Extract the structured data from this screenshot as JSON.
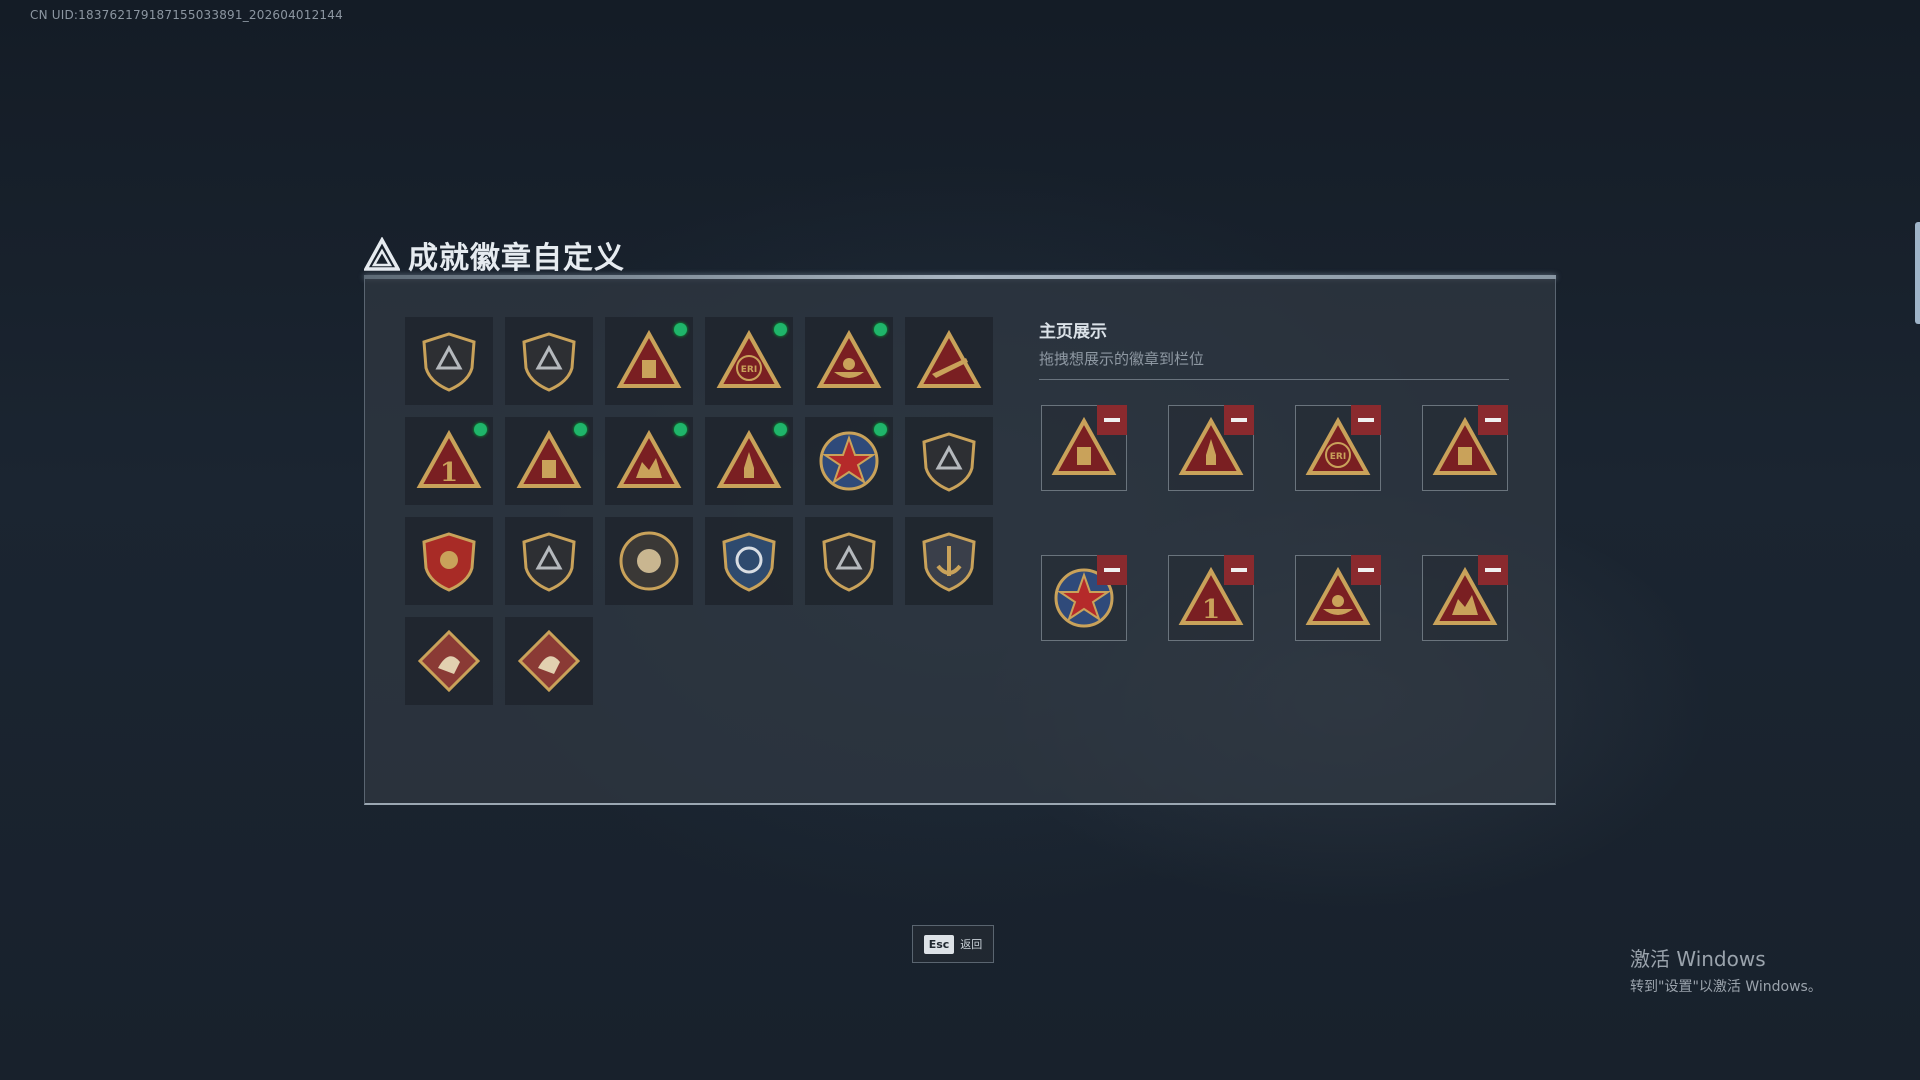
{
  "uid_text": "CN UID:183762179187155033891_202604012144",
  "title": "成就徽章自定义",
  "showcase": {
    "title": "主页展示",
    "subtitle": "拖拽想展示的徽章到栏位"
  },
  "esc": {
    "key": "Esc",
    "label": "返回"
  },
  "windows_watermark": {
    "title": "激活 Windows",
    "subtitle": "转到\"设置\"以激活 Windows。"
  },
  "colors": {
    "accent_green": "#1fb56a",
    "remove_red": "#8a2a2e",
    "gold": "#c9a25a",
    "badge_red": "#7a1f22"
  },
  "badges": [
    {
      "icon": "shield-triangle-badge-icon",
      "new": false
    },
    {
      "icon": "helicopter-shield-badge-icon",
      "new": false
    },
    {
      "icon": "lantern-triangle-badge-icon",
      "new": true
    },
    {
      "icon": "eri-globe-triangle-badge-icon",
      "new": true
    },
    {
      "icon": "boat-triangle-badge-icon",
      "new": true
    },
    {
      "icon": "rifle-triangle-badge-icon",
      "new": false
    },
    {
      "icon": "number-one-triangle-badge-icon",
      "new": true
    },
    {
      "icon": "crate-triangle-badge-icon",
      "new": true
    },
    {
      "icon": "soldiers-triangle-badge-icon",
      "new": true
    },
    {
      "icon": "rocket-triangle-badge-icon",
      "new": true
    },
    {
      "icon": "star-medal-badge-icon",
      "new": true
    },
    {
      "icon": "crest-shield-badge-icon",
      "new": false
    },
    {
      "icon": "eagle-crest-badge-icon",
      "new": false
    },
    {
      "icon": "helmet-shield-badge-icon",
      "new": false
    },
    {
      "icon": "flower-circle-badge-icon",
      "new": false
    },
    {
      "icon": "blue-target-shield-badge-icon",
      "new": false
    },
    {
      "icon": "gun-shield-badge-icon",
      "new": false
    },
    {
      "icon": "gold-anchor-shield-badge-icon",
      "new": false
    },
    {
      "icon": "dragon-diamond-badge-icon",
      "new": false
    },
    {
      "icon": "runner-diamond-badge-icon",
      "new": false
    }
  ],
  "showcase_slots": [
    {
      "icon": "crate-triangle-badge-icon"
    },
    {
      "icon": "rocket-triangle-badge-icon"
    },
    {
      "icon": "eri-globe-triangle-badge-icon"
    },
    {
      "icon": "lantern-triangle-badge-icon"
    },
    {
      "icon": "star-medal-badge-icon"
    },
    {
      "icon": "number-one-triangle-badge-icon"
    },
    {
      "icon": "boat-triangle-badge-icon"
    },
    {
      "icon": "soldiers-triangle-badge-icon"
    }
  ]
}
